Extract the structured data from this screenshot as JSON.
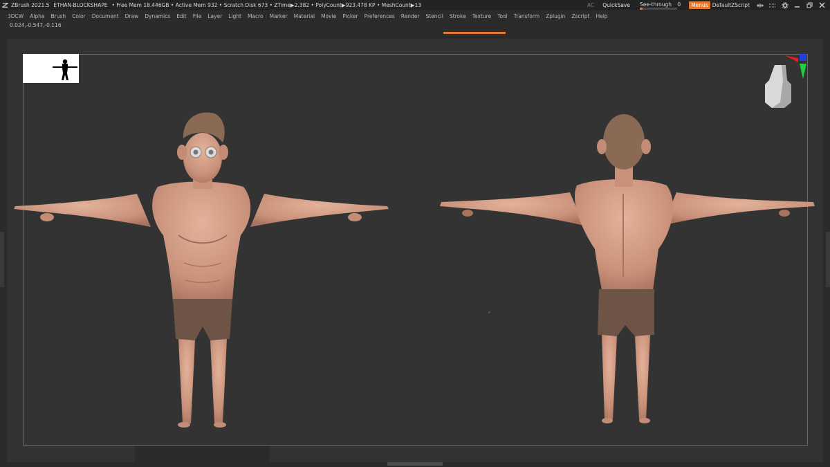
{
  "titlebar": {
    "app": "ZBrush 2021.5",
    "project": "ETHAN-BLOCKSHAPE",
    "stats": "• Free Mem 18.446GB • Active Mem 932 • Scratch Disk 673 •  ZTime▶2.382 • PolyCount▶923.478 KP  • MeshCount▶13",
    "ac": "AC",
    "quicksave": "QuickSave",
    "see_through_label": "See-through",
    "see_through_value": "0",
    "see_through_level": 0,
    "menus": "Menus",
    "default_script": "DefaultZScript"
  },
  "menubar": {
    "items": [
      "3DCW",
      "Alpha",
      "Brush",
      "Color",
      "Document",
      "Draw",
      "Dynamics",
      "Edit",
      "File",
      "Layer",
      "Light",
      "Macro",
      "Marker",
      "Material",
      "Movie",
      "Picker",
      "Preferences",
      "Render",
      "Stencil",
      "Stroke",
      "Texture",
      "Tool",
      "Transform",
      "Zplugin",
      "Zscript",
      "Help"
    ]
  },
  "coords": "0.024,-0.547,-0.116",
  "colors": {
    "accent": "#e5782b",
    "skin": "#d4a088",
    "shorts": "#6e5446",
    "hair": "#8a6a55",
    "background": "#333333"
  },
  "icons": {
    "logo": "zbrush-logo-icon",
    "titlebar": [
      "lock-tool-icon",
      "dots-icon",
      "gear-icon",
      "minimize-icon",
      "restore-icon",
      "close-icon"
    ]
  }
}
